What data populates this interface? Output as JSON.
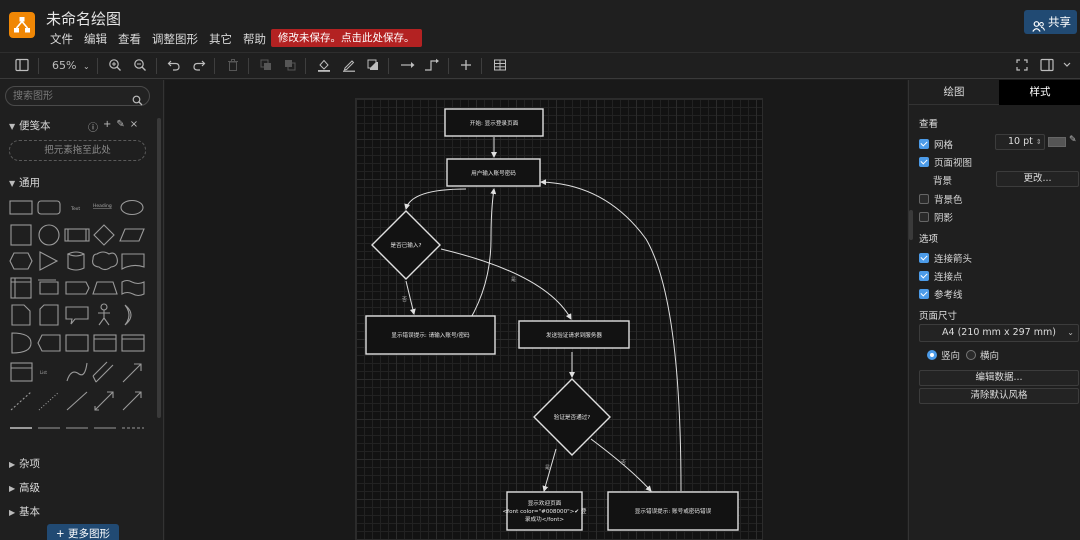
{
  "header": {
    "title": "未命名绘图",
    "menus": [
      "文件",
      "编辑",
      "查看",
      "调整图形",
      "其它",
      "帮助"
    ],
    "unsaved_notice": "修改未保存。点击此处保存。",
    "share_label": "共享"
  },
  "toolbar": {
    "zoom": "65%"
  },
  "sidebar": {
    "search_placeholder": "搜索图形",
    "scratchpad_title": "便笺本",
    "scratchpad_dropzone": "把元素拖至此处",
    "general_title": "通用",
    "collapsed_sections": [
      "杂项",
      "高级",
      "基本"
    ],
    "more_shapes": "+ 更多图形",
    "tiny_shape_labels": {
      "text": "Text",
      "heading": "Heading",
      "list": "List"
    }
  },
  "diagram": {
    "nodes": {
      "start": "开始: 显示登录页面",
      "input": "用户输入账号密码",
      "decision1": "是否已输入?",
      "error1": "显示错误提示: 请输入账号/密码",
      "send": "发送验证请求到服务器",
      "decision2": "验证是否通过?",
      "success_line1": "显示欢迎页面",
      "success_line2": "<font color=\"#008000\">✔ 登",
      "success_line3": "录成功</font>",
      "error2": "显示错误提示: 账号或密码错误"
    },
    "edge_labels": {
      "d1_no": "否",
      "d1_yes": "是",
      "d2_yes": "是",
      "d2_no": "否"
    }
  },
  "format_panel": {
    "tabs": {
      "draw": "绘图",
      "style": "样式"
    },
    "view_heading": "查看",
    "grid_label": "网格",
    "grid_size": "10 pt",
    "page_view_label": "页面视图",
    "background_label": "背景",
    "change_button": "更改...",
    "bg_color_label": "背景色",
    "shadow_label": "阴影",
    "options_heading": "选项",
    "connection_arrows": "连接箭头",
    "connection_points": "连接点",
    "guides": "参考线",
    "paper_heading": "页面尺寸",
    "paper_size": "A4 (210 mm x 297 mm)",
    "portrait": "竖向",
    "landscape": "横向",
    "edit_data": "编辑数据...",
    "clear_default_style": "清除默认风格"
  },
  "colors": {
    "accent": "#4c9be8",
    "logo": "#f08705",
    "unsaved_bg": "#b32222",
    "share_bg": "#214a73"
  }
}
